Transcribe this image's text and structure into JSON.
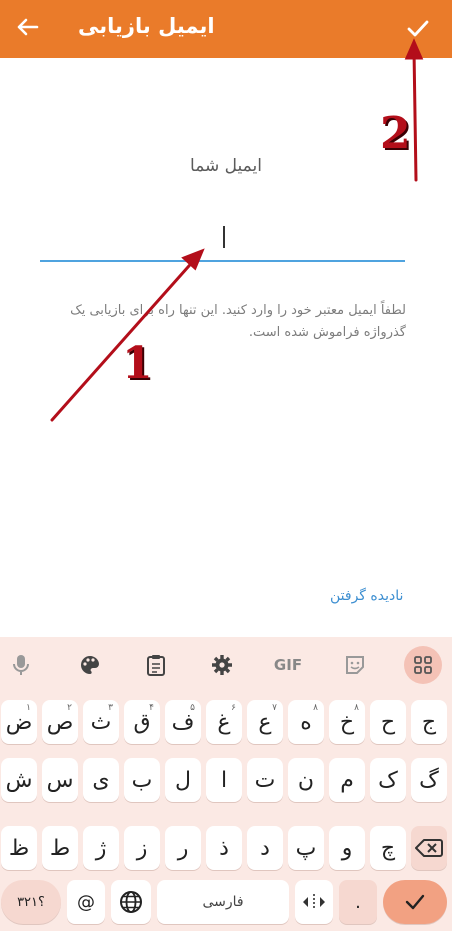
{
  "header": {
    "title": "ایمیل بازیابی",
    "back_icon": "arrow-left-icon",
    "done_icon": "check-icon"
  },
  "form": {
    "email_label": "ایمیل شما",
    "email_value": "",
    "hint": "لطفاً ایمیل معتبر خود را وارد کنید. این تنها راه برای بازیابی یک گذرواژه فراموش شده است.",
    "skip_label": "نادیده گرفتن"
  },
  "annotations": {
    "marker_1": "1",
    "marker_2": "2",
    "arrow_color": "#b30e1a"
  },
  "keyboard": {
    "toolbar": [
      "mic-icon",
      "palette-icon",
      "clipboard-icon",
      "gear-icon",
      "GIF",
      "sticker-icon",
      "apps-grid-icon"
    ],
    "gif_label": "GIF",
    "row1": [
      {
        "k": "ج",
        "h": ""
      },
      {
        "k": "ح",
        "h": ""
      },
      {
        "k": "خ",
        "h": "۸"
      },
      {
        "k": "ه",
        "h": "۸"
      },
      {
        "k": "ع",
        "h": "۷"
      },
      {
        "k": "غ",
        "h": "۶"
      },
      {
        "k": "ف",
        "h": "۵"
      },
      {
        "k": "ق",
        "h": "۴"
      },
      {
        "k": "ث",
        "h": "۳"
      },
      {
        "k": "ص",
        "h": "۲"
      },
      {
        "k": "ض",
        "h": "۱"
      }
    ],
    "row2": [
      "گ",
      "ک",
      "م",
      "ن",
      "ت",
      "ا",
      "ل",
      "ب",
      "ی",
      "س",
      "ش"
    ],
    "row3": [
      "چ",
      "و",
      "پ",
      "د",
      "ذ",
      "ر",
      "ز",
      "ژ",
      "ط",
      "ظ"
    ],
    "space_label": "فارسی",
    "numbers_label": "؟۳۲۱",
    "at_label": "@",
    "accent_color": "#ea7b2a"
  }
}
